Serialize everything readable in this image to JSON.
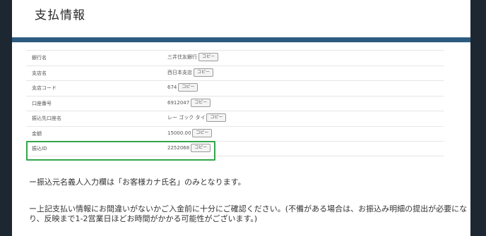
{
  "page": {
    "title": "支払情報"
  },
  "rows": [
    {
      "label": "銀行名",
      "value": "三井住友銀行",
      "copy_label": "コピー"
    },
    {
      "label": "支店名",
      "value": "西日本支店",
      "copy_label": "コピー"
    },
    {
      "label": "支店コード",
      "value": "674",
      "copy_label": "コピー"
    },
    {
      "label": "口座番号",
      "value": "6912047",
      "copy_label": "コピー"
    },
    {
      "label": "振込先口座名",
      "value": "レー ゴック タイ",
      "copy_label": "コピー"
    },
    {
      "label": "金額",
      "value": "15000.00",
      "copy_label": "コピー"
    },
    {
      "label": "振込ID",
      "value": "2252068",
      "copy_label": "コピー"
    }
  ],
  "notes": {
    "note1": "ー振込元名義人入力欄は「お客様カナ氏名」のみとなります。",
    "note2": "ー上記支払い情報にお間違いがないかご入金前に十分にご確認ください。(不備がある場合は、お振込み明細の提出が必要になり、反映まで1-2営業日ほどお時間がかかる可能性がございます。)"
  },
  "colors": {
    "background": "#1c2731",
    "accent_bar": "#2d5b7f",
    "highlight": "#33a64a"
  }
}
